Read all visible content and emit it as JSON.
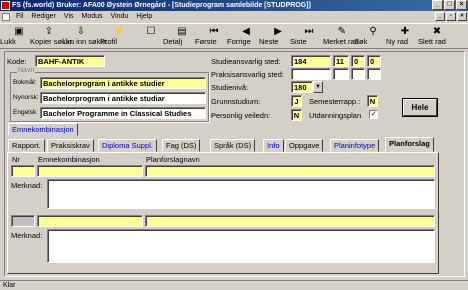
{
  "window": {
    "title": "FS (fs.world) Bruker: AFA00 Øystein Ørnegård - [Studieprogram samlebilde    [STUDPROG]]"
  },
  "menu": [
    "Fil",
    "Rediger",
    "Vis",
    "Modus",
    "Vindu",
    "Hjelp"
  ],
  "toolbar": [
    {
      "label": "Lukk",
      "icon": "close-doc-icon",
      "glyph": "▣"
    },
    {
      "label": "Kopier søkkr.",
      "icon": "copy-query-icon",
      "glyph": "⇪"
    },
    {
      "label": "Lim inn søkkr.",
      "icon": "paste-query-icon",
      "glyph": "⇩"
    },
    {
      "label": "Profil",
      "icon": "profile-icon",
      "glyph": "⚡"
    },
    {
      "label": "",
      "icon": "blank-icon",
      "glyph": "☐"
    },
    {
      "label": "Detalj",
      "icon": "detail-icon",
      "glyph": "▤"
    },
    {
      "label": "Første",
      "icon": "first-icon",
      "glyph": "⏮"
    },
    {
      "label": "Forrige",
      "icon": "previous-icon",
      "glyph": "◀"
    },
    {
      "label": "Neste",
      "icon": "next-icon",
      "glyph": "▶"
    },
    {
      "label": "Siste",
      "icon": "last-icon",
      "glyph": "⏭"
    },
    {
      "label": "Merket rad",
      "icon": "marked-row-icon",
      "glyph": "✎"
    },
    {
      "label": "Søk",
      "icon": "search-icon",
      "glyph": "⚲"
    },
    {
      "label": "Ny rad",
      "icon": "new-row-icon",
      "glyph": "✚"
    },
    {
      "label": "Slett rad",
      "icon": "delete-row-icon",
      "glyph": "✖"
    }
  ],
  "form": {
    "kode_label": "Kode:",
    "kode_value": "BAHF-ANTIK",
    "navn_group": "Navn",
    "bokmal_label": "Bokmål:",
    "bokmal_value": "Bachelorprogram i antikke studier",
    "nynorsk_label": "Nynorsk:",
    "nynorsk_value": "Bachelorprogram i antikke studiar",
    "engelsk_label": "Engelsk:",
    "engelsk_value": "Bachelor Programme in Classical Studies",
    "studieansvarlig_label": "Studieansvarlig sted:",
    "studieansvarlig_values": [
      "184",
      "11",
      "0",
      "0"
    ],
    "praksisansvarlig_label": "Praksisansvarlig sted:",
    "studieniva_label": "Studienivå:",
    "studieniva_value": "180",
    "grunnstudium_label": "Grunnstudium:",
    "grunnstudium_value": "J",
    "semesterrapp_label": "Semesterrapp.:",
    "semesterrapp_value": "N",
    "personlig_label": "Personlig veiledn:",
    "personlig_value": "N",
    "utdanningsplan_label": "Utdanningsplan",
    "utdanningsplan_checked": "✓",
    "hele_button": "Hele"
  },
  "outer_tab": "Emnekombinasjon",
  "tabs": [
    {
      "label": "Rapport.",
      "blue": false
    },
    {
      "label": "Praksiskrav",
      "blue": false
    },
    {
      "label": "Diploma Suppl.",
      "blue": true
    },
    {
      "label": "Fag (DS)",
      "blue": false
    },
    {
      "label": "Språk (DS)",
      "blue": false
    },
    {
      "label": "Info",
      "blue": true
    },
    {
      "label": "Oppgave",
      "blue": false
    },
    {
      "label": "Planinfotype",
      "blue": true
    },
    {
      "label": "Planforslag",
      "blue": false,
      "active": true
    }
  ],
  "grid": {
    "col_nr": "Nr",
    "col_emnekombinasjon": "Emnekombinasjon",
    "col_planforslagnavn": "Planforslagnavn",
    "merknad_label": "Merknad:"
  },
  "status": "Klar"
}
